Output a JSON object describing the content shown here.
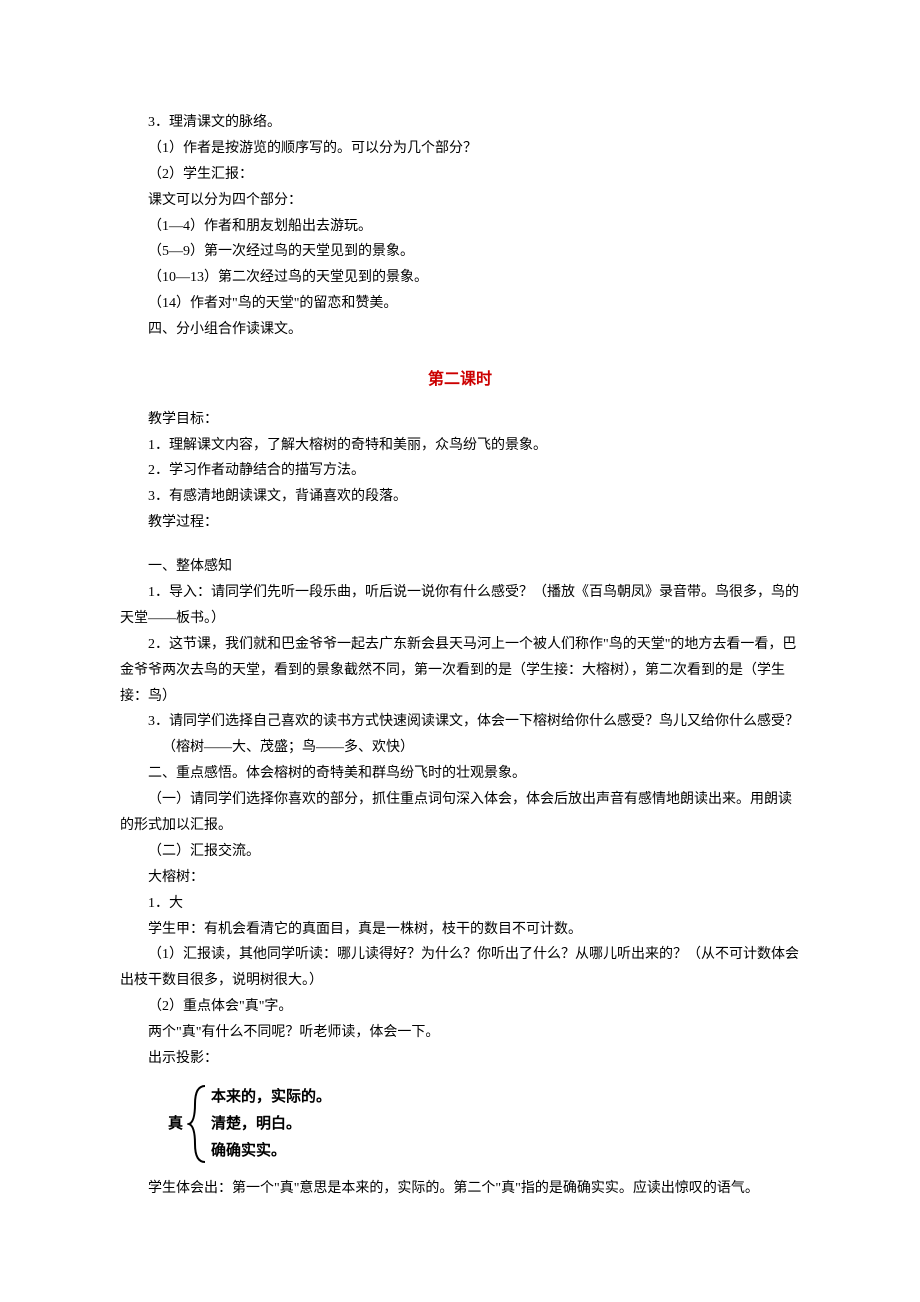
{
  "top": {
    "item3": "3．理清课文的脉络。",
    "q1": "（1）作者是按游览的顺序写的。可以分为几个部分？",
    "q2": "（2）学生汇报：",
    "partsIntro": "课文可以分为四个部分：",
    "p1": "（1—4）作者和朋友划船出去游玩。",
    "p2": "（5—9）第一次经过鸟的天堂见到的景象。",
    "p3": "（10—13）第二次经过鸟的天堂见到的景象。",
    "p4": "（14）作者对\"鸟的天堂\"的留恋和赞美。",
    "four": "四、分小组合作读课文。"
  },
  "lesson2": {
    "title": "第二课时",
    "goalLabel": "教学目标：",
    "g1": "1．理解课文内容，了解大榕树的奇特和美丽，众鸟纷飞的景象。",
    "g2": "2．学习作者动静结合的描写方法。",
    "g3": "3．有感清地朗读课文，背诵喜欢的段落。",
    "procLabel": "教学过程：",
    "s1title": "一、整体感知",
    "s1p1": "1．导入：请同学们先听一段乐曲，听后说一说你有什么感受？（播放《百鸟朝凤》录音带。鸟很多，鸟的天堂——板书。）",
    "s1p2": "2．这节课，我们就和巴金爷爷一起去广东新会县天马河上一个被人们称作\"鸟的天堂\"的地方去看一看，巴金爷爷两次去鸟的天堂，看到的景象截然不同，第一次看到的是（学生接：大榕树），第二次看到的是（学生接：鸟）",
    "s1p3": "3．请同学们选择自己喜欢的读书方式快速阅读课文，体会一下榕树给你什么感受？鸟儿又给你什么感受？",
    "s1note": "（榕树——大、茂盛；鸟——多、欢快）",
    "s2title": "二、重点感悟。体会榕树的奇特美和群鸟纷飞时的壮观景象。",
    "s2a": "（一）请同学们选择你喜欢的部分，抓住重点词句深入体会，体会后放出声音有感情地朗读出来。用朗读的形式加以汇报。",
    "s2b": "（二）汇报交流。",
    "tree": "大榕树：",
    "treeBig": "1．大",
    "studA": "学生甲：有机会看清它的真面目，真是一株树，枝干的数目不可计数。",
    "rep1": "（1）汇报读，其他同学听读：哪儿读得好？为什么？你听出了什么？从哪儿听出来的？（从不可计数体会出枝干数目很多，说明树很大。）",
    "rep2": "（2）重点体会\"真\"字。",
    "twoZhen": "两个\"真\"有什么不同呢？听老师读，体会一下。",
    "proj": "出示投影：",
    "brace": {
      "label": "真",
      "i1": "本来的，实际的。",
      "i2": "清楚，明白。",
      "i3": "确确实实。"
    },
    "conclusion": "学生体会出：第一个\"真\"意思是本来的，实际的。第二个\"真\"指的是确确实实。应读出惊叹的语气。"
  }
}
